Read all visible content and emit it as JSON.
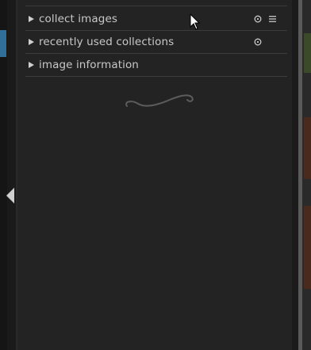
{
  "modules": [
    {
      "label": "collect images",
      "expanded": false,
      "icons": [
        "reset-icon",
        "presets-icon"
      ]
    },
    {
      "label": "recently used collections",
      "expanded": false,
      "icons": [
        "reset-icon"
      ]
    },
    {
      "label": "image information",
      "expanded": false,
      "icons": []
    }
  ],
  "icons": {
    "reset": "⊙",
    "presets": "≡",
    "expand_arrow": "▸"
  },
  "colors": {
    "panel_bg": "#232323",
    "text": "#c8c8c8",
    "separator": "#3c3c3c",
    "accent": "#2f6f9a"
  }
}
